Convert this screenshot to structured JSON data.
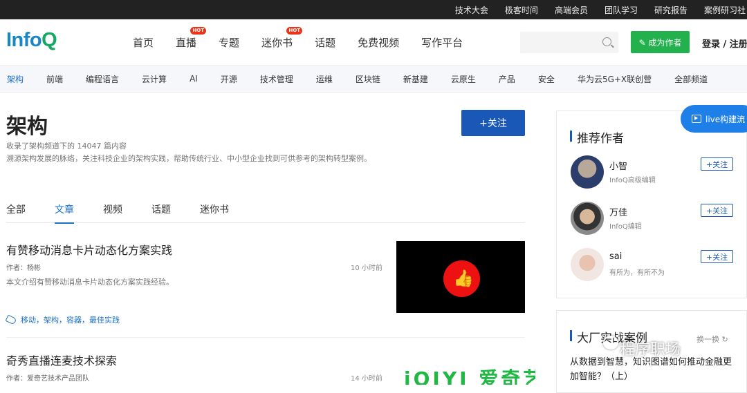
{
  "topbar": {
    "links": [
      "技术大会",
      "极客时间",
      "高端会员",
      "团队学习",
      "研究报告",
      "案例研习社"
    ]
  },
  "header": {
    "logo_main": "Info",
    "logo_q": "Q",
    "nav": [
      {
        "label": "首页",
        "hot": false
      },
      {
        "label": "直播",
        "hot": true
      },
      {
        "label": "专题",
        "hot": false
      },
      {
        "label": "迷你书",
        "hot": true
      },
      {
        "label": "话题",
        "hot": false
      },
      {
        "label": "免费视频",
        "hot": false
      },
      {
        "label": "写作平台",
        "hot": false
      }
    ],
    "hot_label": "HOT",
    "write_button": "✎ 成为作者",
    "login": "登录 / 注册"
  },
  "channels": {
    "items": [
      "架构",
      "前端",
      "编程语言",
      "云计算",
      "AI",
      "开源",
      "技术管理",
      "运维",
      "区块链",
      "新基建",
      "云原生",
      "产品",
      "安全",
      "华为云5G+X联创营",
      "全部频道"
    ],
    "active_index": 0,
    "active_color": "#1a6fc9"
  },
  "main": {
    "title": "架构",
    "follow_button": "+关注",
    "desc_line1": "收录了架构频道下的 14047 篇内容",
    "desc_line2": "溯源架构发展的脉络，关注科技企业的架构实践，帮助传统行业、中小型企业找到可供参考的架构转型案例。",
    "tabs": [
      "全部",
      "文章",
      "视频",
      "话题",
      "迷你书"
    ],
    "active_tab": 1
  },
  "articles": [
    {
      "title": "有赞移动消息卡片动态化方案实践",
      "author": "作者：杨彬",
      "time": "10 小时前",
      "summary": "本文介绍有赞移动消息卡片动态化方案实践经验。",
      "tags": "移动，架构，容器，最佳实践"
    },
    {
      "title": "奇秀直播连麦技术探索",
      "author": "作者：爱奇艺技术产品团队",
      "time": "14 小时前",
      "thumb_text": "iQIYI 爱奇艺"
    }
  ],
  "sidebar": {
    "recommend_title": "推荐作者",
    "authors": [
      {
        "name": "小智",
        "role": "InfoQ高级编辑",
        "follow": "+关注"
      },
      {
        "name": "万佳",
        "role": "InfoQ编辑",
        "follow": "+关注"
      },
      {
        "name": "sai",
        "role": "有所为，有所不为",
        "follow": "+关注"
      }
    ],
    "live_button": "live构建流",
    "cases_title": "大厂实战案例",
    "refresh": "换一换",
    "case_text": "从数据到智慧，知识图谱如何推动金融更加智能？（上）",
    "watermark": "程序职场"
  }
}
